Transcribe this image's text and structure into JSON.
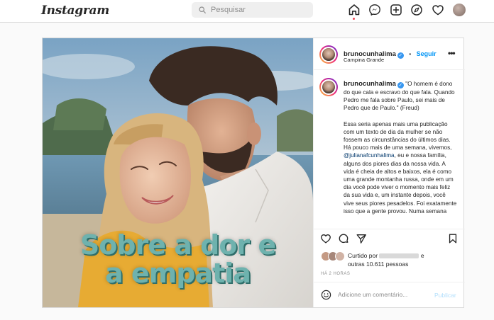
{
  "topbar": {
    "logo": "Instagram",
    "search_placeholder": "Pesquisar",
    "icons": [
      "home-icon",
      "messenger-icon",
      "new-post-icon",
      "explore-icon",
      "heart-icon",
      "profile-avatar"
    ]
  },
  "post": {
    "author": {
      "username": "brunocunhalima",
      "follow_label": "Seguir",
      "separator": "•",
      "location": "Campina Grande"
    },
    "image": {
      "overlay_line1": "Sobre a dor e",
      "overlay_line2": "a empatia",
      "overlay_color": "#6eb2ae"
    },
    "caption": {
      "username": "brunocunhalima",
      "quote": "\"O homem é dono do que cala e escravo do que fala. Quando Pedro me fala sobre Paulo, sei mais de Pedro que de Paulo.\" (Freud)",
      "body_part1": "Essa seria apenas mais uma publicação com um texto de dia da mulher se não fossem as circunstâncias do últimos dias. Há pouco mais de uma semana, vivemos, ",
      "mention": "@julianafcunhalima",
      "body_part2": ", eu e nossa família, alguns dos piores dias da nossa vida. A vida é cheia de altos e baixos, ela é como uma grande montanha russa, onde em um dia você pode viver o momento mais feliz da sua vida e, um instante depois, você vive seus piores pesadelos. Foi exatamente isso que a gente provou. Numa semana"
    },
    "likes": {
      "prefix": "Curtido por",
      "suffix": "e",
      "others": "outras 10.611 pessoas"
    },
    "time_ago": "HÁ 2 HORAS",
    "comment": {
      "placeholder": "Adicione um comentário...",
      "publish_label": "Publicar"
    }
  }
}
